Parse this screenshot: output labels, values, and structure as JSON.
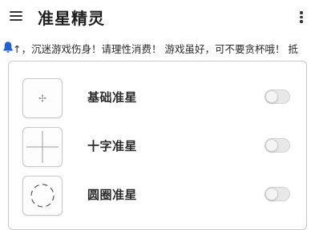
{
  "app": {
    "title": "准星精灵",
    "menu_icon": "hamburger-menu-icon",
    "more_icon": "more-vertical-icon"
  },
  "notice": {
    "icon": "bell-icon",
    "icon_color": "#1e63d6",
    "text": "↑，沉迷游戏伤身！请理性消费！ 游戏虽好，可不要贪杯哦！ 抵"
  },
  "crosshairs": [
    {
      "label": "基础准星",
      "icon": "dot-crosshair-icon",
      "enabled": false
    },
    {
      "label": "十字准星",
      "icon": "cross-crosshair-icon",
      "enabled": false
    },
    {
      "label": "圆圈准星",
      "icon": "circle-crosshair-icon",
      "enabled": false
    }
  ]
}
